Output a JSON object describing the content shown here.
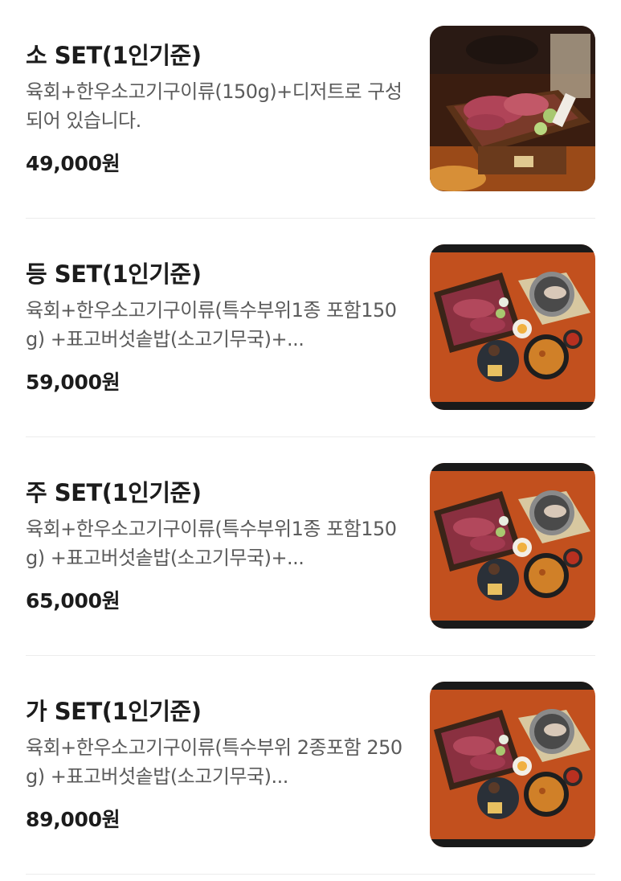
{
  "menu": {
    "items": [
      {
        "title": "소 SET(1인기준)",
        "description": "육회+한우소고기구이류(150g)+디저트로 구성되어 있습니다.",
        "price": "49,000원"
      },
      {
        "title": "등 SET(1인기준)",
        "description": "육회+한우소고기구이류(특수부위1종 포함150g) +표고버섯솥밥(소고기무국)+...",
        "price": "59,000원"
      },
      {
        "title": "주 SET(1인기준)",
        "description": "육회+한우소고기구이류(특수부위1종 포함150g) +표고버섯솥밥(소고기무국)+...",
        "price": "65,000원"
      },
      {
        "title": "가 SET(1인기준)",
        "description": "육회+한우소고기구이류(특수부위 2종포함 250g) +표고버섯솥밥(소고기무국)...",
        "price": "89,000원"
      }
    ]
  }
}
